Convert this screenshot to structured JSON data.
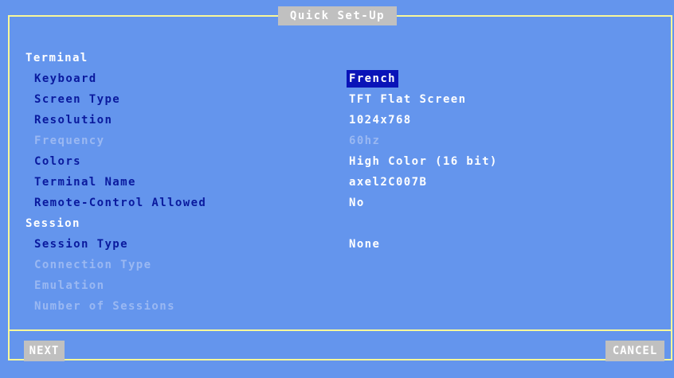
{
  "window": {
    "title": "Quick Set-Up"
  },
  "sections": {
    "terminal": {
      "label": "Terminal",
      "fields": {
        "keyboard": {
          "label": "Keyboard",
          "value": "French"
        },
        "screen_type": {
          "label": "Screen Type",
          "value": "TFT Flat Screen"
        },
        "resolution": {
          "label": "Resolution",
          "value": "1024x768"
        },
        "frequency": {
          "label": "Frequency",
          "value": "60hz"
        },
        "colors": {
          "label": "Colors",
          "value": "High Color (16 bit)"
        },
        "terminal_name": {
          "label": "Terminal Name",
          "value": "axel2C007B"
        },
        "remote_control": {
          "label": "Remote-Control Allowed",
          "value": "No"
        }
      }
    },
    "session": {
      "label": "Session",
      "fields": {
        "session_type": {
          "label": "Session Type",
          "value": "None"
        },
        "connection_type": {
          "label": "Connection Type"
        },
        "emulation": {
          "label": "Emulation"
        },
        "number_of_sessions": {
          "label": "Number of Sessions"
        }
      }
    }
  },
  "buttons": {
    "next": "NEXT",
    "cancel": "CANCEL"
  },
  "colors": {
    "background": "#6495ed",
    "frame": "#f8f89a",
    "label": "#0a1a9e",
    "disabled": "#9ab8f2",
    "selection": "#0a14b8",
    "button": "#c0c0c0"
  }
}
